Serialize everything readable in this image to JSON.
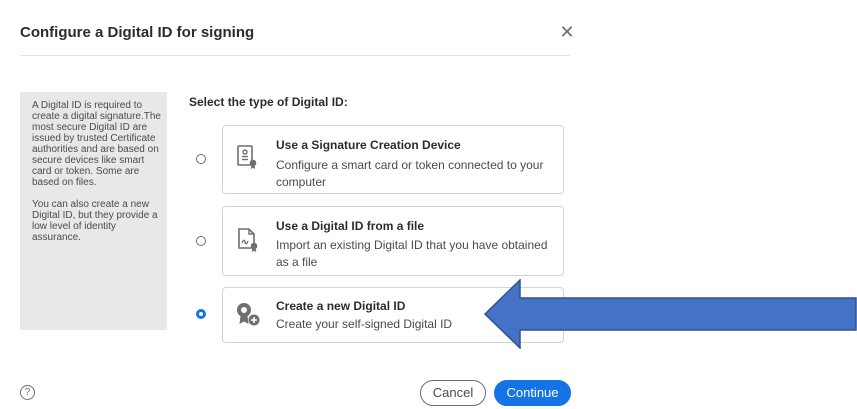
{
  "dialog": {
    "title": "Configure a Digital ID for signing",
    "close_icon": "close-icon",
    "info": {
      "paragraph1": "A Digital ID is required to create a digital signature.The most secure Digital ID are issued by trusted Certificate authorities and are based on secure devices like smart card or token. Some are based on files.",
      "paragraph2": "You can also create a new Digital ID, but they provide a low level of identity assurance."
    },
    "section_heading": "Select the type of Digital ID:",
    "options": [
      {
        "title": "Use a Signature Creation Device",
        "description": "Configure a smart card or token connected to your computer",
        "icon": "certificate-device-icon",
        "selected": false
      },
      {
        "title": "Use a Digital ID from a file",
        "description": "Import an existing Digital ID that you have obtained as a file",
        "icon": "id-file-icon",
        "selected": false
      },
      {
        "title": "Create a new Digital ID",
        "description": "Create your self-signed Digital ID",
        "icon": "new-id-icon",
        "selected": true
      }
    ],
    "help_icon": "help-icon",
    "help_glyph": "?",
    "buttons": {
      "cancel": "Cancel",
      "continue": "Continue"
    }
  },
  "colors": {
    "accent": "#1473e6",
    "panel_bg": "#e8e8e8",
    "annotation_arrow": "#4472c4"
  }
}
